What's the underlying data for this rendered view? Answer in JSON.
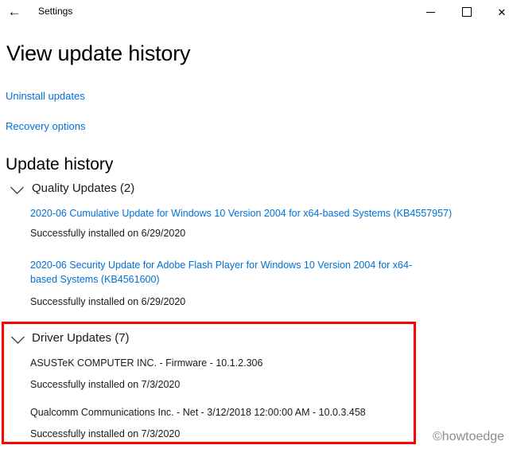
{
  "colors": {
    "link_blue": "#0070d6",
    "highlight_red": "#fe0000",
    "watermark_gray": "#8c8c8c",
    "background": "#ffffff"
  },
  "icons": {
    "back": "←",
    "minimize": "minimize-dash",
    "maximize": "maximize-box",
    "close": "✕",
    "chevron_down": "∨"
  },
  "titlebar": {
    "title": "Settings"
  },
  "page": {
    "title": "View update history",
    "links": [
      {
        "label": "Uninstall updates"
      },
      {
        "label": "Recovery options"
      }
    ]
  },
  "history": {
    "heading": "Update history",
    "sections": [
      {
        "label": "Quality Updates (2)",
        "entries": [
          {
            "title": "2020-06 Cumulative Update for Windows 10 Version 2004 for x64-based Systems (KB4557957)",
            "status": "Successfully installed on 6/29/2020"
          },
          {
            "title": "2020-06 Security Update for Adobe Flash Player for Windows 10 Version 2004 for x64-based Systems (KB4561600)",
            "status": "Successfully installed on 6/29/2020"
          }
        ]
      },
      {
        "label": "Driver Updates (7)",
        "entries": [
          {
            "title": "ASUSTeK COMPUTER INC. - Firmware - 10.1.2.306",
            "status": "Successfully installed on 7/3/2020"
          },
          {
            "title": "Qualcomm Communications Inc. - Net - 3/12/2018 12:00:00 AM - 10.0.3.458",
            "status": "Successfully installed on 7/3/2020"
          }
        ]
      }
    ]
  },
  "watermark": "©howtoedge"
}
